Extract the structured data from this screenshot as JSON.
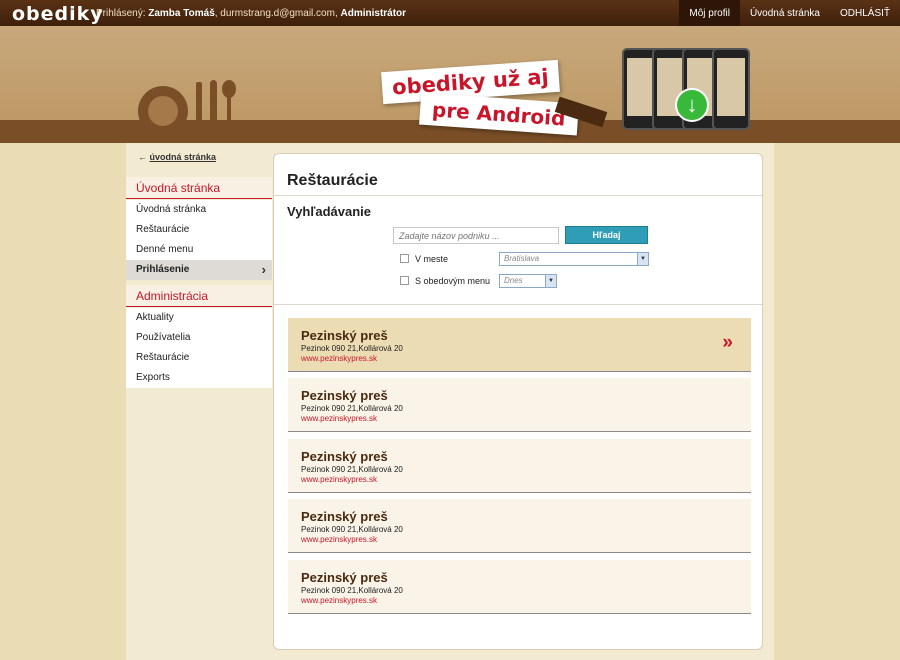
{
  "header": {
    "logo": "obediky",
    "user_prefix": "Prihlásený: ",
    "user_name": "Zamba Tomáš",
    "user_email": ", durmstrang.d@gmail.com, ",
    "user_role": "Administrátor",
    "nav": [
      "Môj profil",
      "Úvodná stránka",
      "ODHLÁSIŤ"
    ]
  },
  "banner": {
    "promo_line1": "obediky už aj",
    "promo_line2": "pre Android"
  },
  "sidebar": {
    "back_arrow": "←",
    "back_label": "úvodná stránka",
    "section1_title": "Úvodná stránka",
    "section1_items": [
      "Úvodná stránka",
      "Reštaurácie",
      "Denné menu",
      "Prihlásenie"
    ],
    "section2_title": "Administrácia",
    "section2_items": [
      "Aktuality",
      "Používatelia",
      "Reštaurácie",
      "Exports"
    ],
    "active_chevron": "›"
  },
  "main": {
    "title": "Reštaurácie",
    "search_title": "Vyhľadávanie",
    "search_placeholder": "Zadajte názov podniku ...",
    "search_button": "Hľadaj",
    "filter_city_label": "V meste",
    "filter_city_value": "Bratislava",
    "filter_menu_label": "S obedovým menu",
    "filter_menu_value": "Dnes",
    "restaurants": [
      {
        "name": "Pezinský preš",
        "address": "Pezinok 090 21,Kollárová 20",
        "url": "www.pezinskypres.sk"
      },
      {
        "name": "Pezinský preš",
        "address": "Pezinok 090 21,Kollárová 20",
        "url": "www.pezinskypres.sk"
      },
      {
        "name": "Pezinský preš",
        "address": "Pezinok 090 21,Kollárová 20",
        "url": "www.pezinskypres.sk"
      },
      {
        "name": "Pezinský preš",
        "address": "Pezinok 090 21,Kollárová 20",
        "url": "www.pezinskypres.sk"
      },
      {
        "name": "Pezinský preš",
        "address": "Pezinok 090 21,Kollárová 20",
        "url": "www.pezinskypres.sk"
      }
    ],
    "selected_arrow": "»"
  },
  "colors": {
    "accent_red": "#c8152a",
    "header_brown": "#3e200b",
    "button_blue": "#2f9db6"
  }
}
